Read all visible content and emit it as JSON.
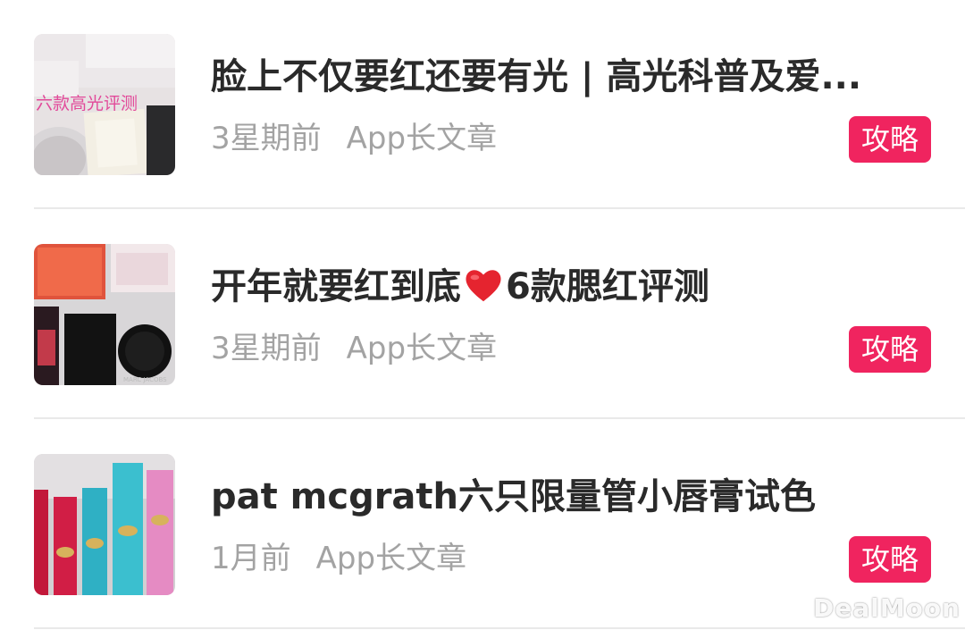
{
  "articles": [
    {
      "title": "脸上不仅要红还要有光 | 高光科普及爱...",
      "time": "3星期前",
      "source": "App长文章",
      "tag": "攻略",
      "thumb_overlay_text": "六款高光评测"
    },
    {
      "title_before": "开年就要红到底",
      "title_emoji": "heart-emoji",
      "title_after": "6款腮红评测",
      "time": "3星期前",
      "source": "App长文章",
      "tag": "攻略",
      "thumb_brand_text": "MARC JACOBS"
    },
    {
      "title": "pat mcgrath六只限量管小唇膏试色",
      "time": "1月前",
      "source": "App长文章",
      "tag": "攻略"
    }
  ],
  "watermark": "DealMoon",
  "colors": {
    "tag_bg": "#f0245f",
    "title": "#2a2a2a",
    "meta": "#a3a3a3",
    "divider": "#e9e9e9"
  }
}
